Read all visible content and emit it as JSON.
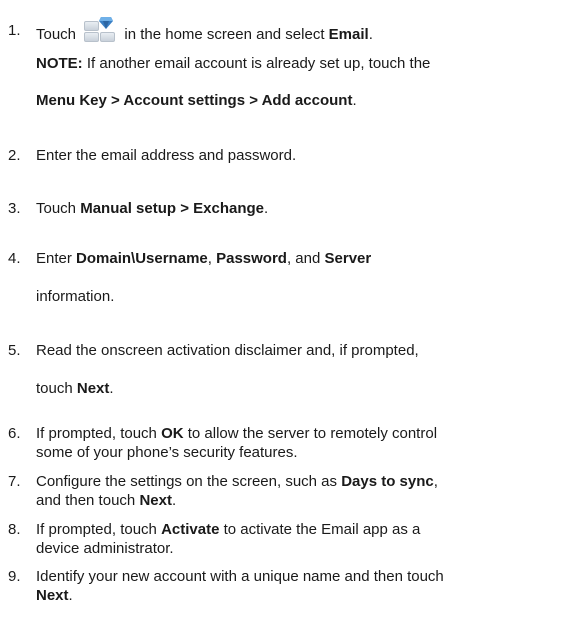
{
  "steps": [
    {
      "num": "1.",
      "pre": "Touch",
      "icon": "home-apps-icon",
      "post": "in the home screen and select",
      "bold": "Email",
      "end": "."
    },
    {
      "note_label": "NOTE:",
      "note_text": "If another email account is already set up, touch the",
      "note_bold": "Menu Key > Account settings > Add account",
      "note_end": "."
    },
    {
      "num": "2.",
      "text": "Enter the email address and password."
    },
    {
      "num": "3.",
      "pre": "Touch",
      "bold": "Manual setup > Exchange",
      "end": "."
    },
    {
      "num": "4.",
      "pre": "Enter",
      "bold1": "Domain\\Username",
      "sep1": ",",
      "bold2": "Password",
      "sep2": ", and",
      "bold3": "Server",
      "line2": "information."
    },
    {
      "num": "5.",
      "line1": "Read the onscreen activation disclaimer and, if prompted,",
      "line2_pre": "touch",
      "line2_bold": "Next",
      "line2_end": "."
    },
    {
      "num": "6.",
      "pre": "If prompted, touch",
      "bold": "OK",
      "post": "to allow the server to remotely control",
      "line2": "some of your phone’s security features."
    },
    {
      "num": "7.",
      "pre": "Configure the settings on the screen, such as",
      "bold": "Days to sync",
      "end": ",",
      "line2_pre": "and then touch",
      "line2_bold": "Next",
      "line2_end": "."
    },
    {
      "num": "8.",
      "pre": "If prompted, touch",
      "bold": "Activate",
      "post": "to activate the Email app as a",
      "line2": "device administrator."
    },
    {
      "num": "9.",
      "line1": "Identify your new account with a unique name and then touch",
      "line2_bold": "Next",
      "line2_end": "."
    }
  ]
}
